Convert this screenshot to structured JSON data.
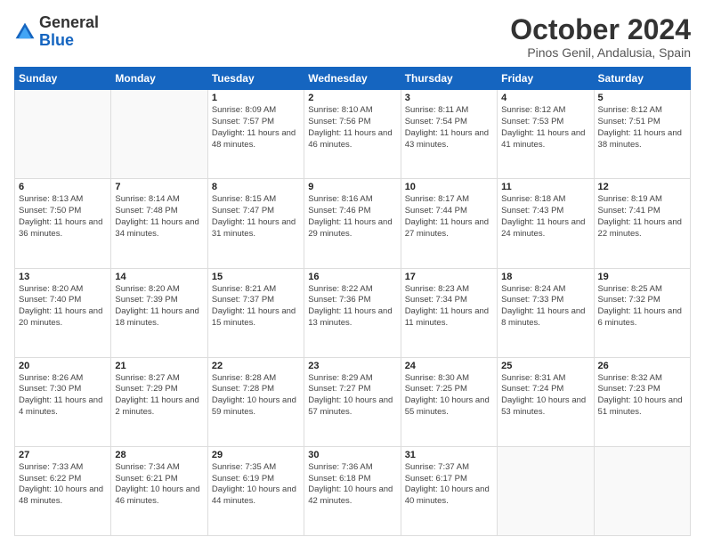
{
  "logo": {
    "general": "General",
    "blue": "Blue"
  },
  "header": {
    "month": "October 2024",
    "location": "Pinos Genil, Andalusia, Spain"
  },
  "weekdays": [
    "Sunday",
    "Monday",
    "Tuesday",
    "Wednesday",
    "Thursday",
    "Friday",
    "Saturday"
  ],
  "weeks": [
    [
      {
        "day": "",
        "info": ""
      },
      {
        "day": "",
        "info": ""
      },
      {
        "day": "1",
        "info": "Sunrise: 8:09 AM\nSunset: 7:57 PM\nDaylight: 11 hours and 48 minutes."
      },
      {
        "day": "2",
        "info": "Sunrise: 8:10 AM\nSunset: 7:56 PM\nDaylight: 11 hours and 46 minutes."
      },
      {
        "day": "3",
        "info": "Sunrise: 8:11 AM\nSunset: 7:54 PM\nDaylight: 11 hours and 43 minutes."
      },
      {
        "day": "4",
        "info": "Sunrise: 8:12 AM\nSunset: 7:53 PM\nDaylight: 11 hours and 41 minutes."
      },
      {
        "day": "5",
        "info": "Sunrise: 8:12 AM\nSunset: 7:51 PM\nDaylight: 11 hours and 38 minutes."
      }
    ],
    [
      {
        "day": "6",
        "info": "Sunrise: 8:13 AM\nSunset: 7:50 PM\nDaylight: 11 hours and 36 minutes."
      },
      {
        "day": "7",
        "info": "Sunrise: 8:14 AM\nSunset: 7:48 PM\nDaylight: 11 hours and 34 minutes."
      },
      {
        "day": "8",
        "info": "Sunrise: 8:15 AM\nSunset: 7:47 PM\nDaylight: 11 hours and 31 minutes."
      },
      {
        "day": "9",
        "info": "Sunrise: 8:16 AM\nSunset: 7:46 PM\nDaylight: 11 hours and 29 minutes."
      },
      {
        "day": "10",
        "info": "Sunrise: 8:17 AM\nSunset: 7:44 PM\nDaylight: 11 hours and 27 minutes."
      },
      {
        "day": "11",
        "info": "Sunrise: 8:18 AM\nSunset: 7:43 PM\nDaylight: 11 hours and 24 minutes."
      },
      {
        "day": "12",
        "info": "Sunrise: 8:19 AM\nSunset: 7:41 PM\nDaylight: 11 hours and 22 minutes."
      }
    ],
    [
      {
        "day": "13",
        "info": "Sunrise: 8:20 AM\nSunset: 7:40 PM\nDaylight: 11 hours and 20 minutes."
      },
      {
        "day": "14",
        "info": "Sunrise: 8:20 AM\nSunset: 7:39 PM\nDaylight: 11 hours and 18 minutes."
      },
      {
        "day": "15",
        "info": "Sunrise: 8:21 AM\nSunset: 7:37 PM\nDaylight: 11 hours and 15 minutes."
      },
      {
        "day": "16",
        "info": "Sunrise: 8:22 AM\nSunset: 7:36 PM\nDaylight: 11 hours and 13 minutes."
      },
      {
        "day": "17",
        "info": "Sunrise: 8:23 AM\nSunset: 7:34 PM\nDaylight: 11 hours and 11 minutes."
      },
      {
        "day": "18",
        "info": "Sunrise: 8:24 AM\nSunset: 7:33 PM\nDaylight: 11 hours and 8 minutes."
      },
      {
        "day": "19",
        "info": "Sunrise: 8:25 AM\nSunset: 7:32 PM\nDaylight: 11 hours and 6 minutes."
      }
    ],
    [
      {
        "day": "20",
        "info": "Sunrise: 8:26 AM\nSunset: 7:30 PM\nDaylight: 11 hours and 4 minutes."
      },
      {
        "day": "21",
        "info": "Sunrise: 8:27 AM\nSunset: 7:29 PM\nDaylight: 11 hours and 2 minutes."
      },
      {
        "day": "22",
        "info": "Sunrise: 8:28 AM\nSunset: 7:28 PM\nDaylight: 10 hours and 59 minutes."
      },
      {
        "day": "23",
        "info": "Sunrise: 8:29 AM\nSunset: 7:27 PM\nDaylight: 10 hours and 57 minutes."
      },
      {
        "day": "24",
        "info": "Sunrise: 8:30 AM\nSunset: 7:25 PM\nDaylight: 10 hours and 55 minutes."
      },
      {
        "day": "25",
        "info": "Sunrise: 8:31 AM\nSunset: 7:24 PM\nDaylight: 10 hours and 53 minutes."
      },
      {
        "day": "26",
        "info": "Sunrise: 8:32 AM\nSunset: 7:23 PM\nDaylight: 10 hours and 51 minutes."
      }
    ],
    [
      {
        "day": "27",
        "info": "Sunrise: 7:33 AM\nSunset: 6:22 PM\nDaylight: 10 hours and 48 minutes."
      },
      {
        "day": "28",
        "info": "Sunrise: 7:34 AM\nSunset: 6:21 PM\nDaylight: 10 hours and 46 minutes."
      },
      {
        "day": "29",
        "info": "Sunrise: 7:35 AM\nSunset: 6:19 PM\nDaylight: 10 hours and 44 minutes."
      },
      {
        "day": "30",
        "info": "Sunrise: 7:36 AM\nSunset: 6:18 PM\nDaylight: 10 hours and 42 minutes."
      },
      {
        "day": "31",
        "info": "Sunrise: 7:37 AM\nSunset: 6:17 PM\nDaylight: 10 hours and 40 minutes."
      },
      {
        "day": "",
        "info": ""
      },
      {
        "day": "",
        "info": ""
      }
    ]
  ]
}
